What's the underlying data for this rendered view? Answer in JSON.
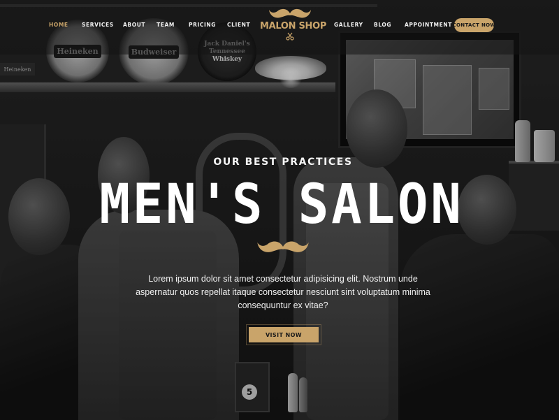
{
  "nav": {
    "items": [
      {
        "label": "HOME",
        "active": true
      },
      {
        "label": "SERVICES"
      },
      {
        "label": "ABOUT"
      },
      {
        "label": "TEAM"
      },
      {
        "label": "PRICING"
      },
      {
        "label": "CLIENT"
      },
      {
        "label": "GALLERY"
      },
      {
        "label": "BLOG"
      },
      {
        "label": "APPOINTMENT"
      }
    ],
    "contact_label": "CONTACT NOW"
  },
  "logo": {
    "text": "MALON SHOP",
    "icon": "mustache-icon",
    "sub_icon": "scissors-icon"
  },
  "hero": {
    "kicker": "OUR BEST PRACTICES",
    "title": "MEN'S SALON",
    "divider_icon": "mustache-icon",
    "body": "Lorem ipsum dolor sit amet consectetur adipisicing elit. Nostrum unde aspernatur quos repellat itaque consectetur nesciunt sint voluptatum minima consequuntur ex vitae?",
    "button_label": "VISIT NOW"
  },
  "background": {
    "signs": [
      "Heineken",
      "Budweiser",
      "Jack Daniel's Tennessee Whiskey"
    ],
    "corner_sign": "Heineken",
    "box_number": "5"
  },
  "colors": {
    "accent": "#c9a46a",
    "text": "#ffffff",
    "nav_text": "#f2f2f2"
  }
}
